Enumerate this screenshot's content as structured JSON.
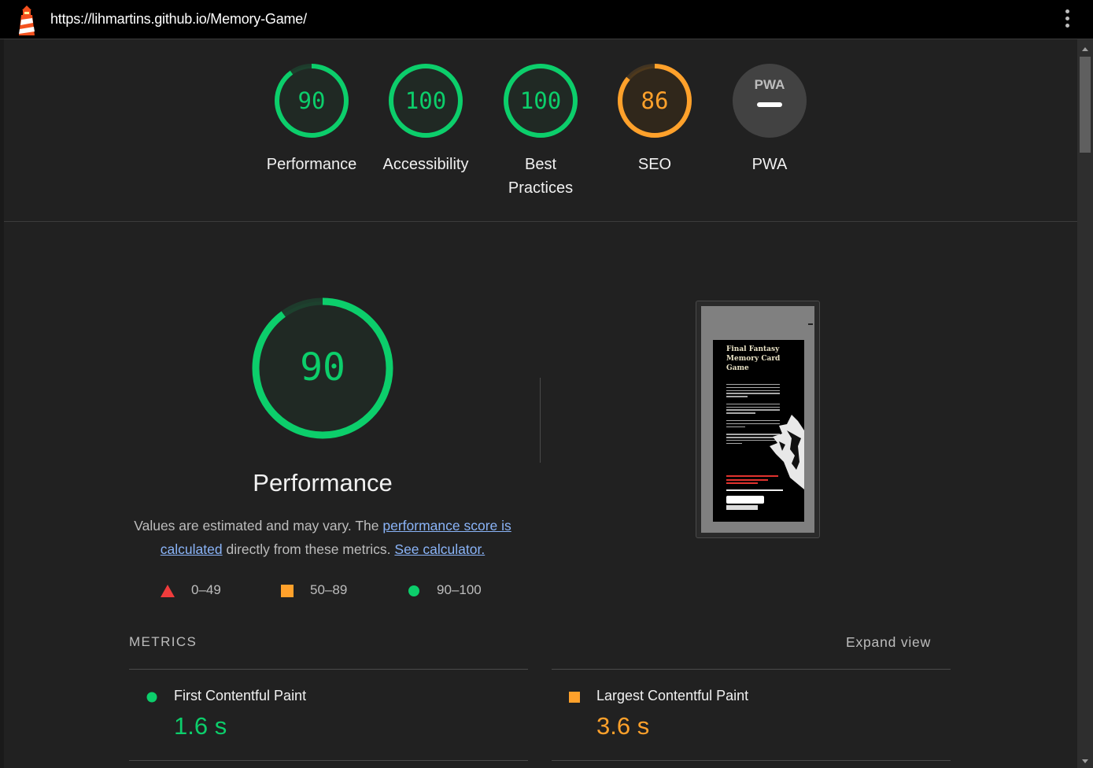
{
  "browser": {
    "url": "https://lihmartins.github.io/Memory-Game/"
  },
  "gauges": [
    {
      "score": "90",
      "label": "Performance",
      "status": "pass"
    },
    {
      "score": "100",
      "label": "Accessibility",
      "status": "pass"
    },
    {
      "score": "100",
      "label": "Best Practices",
      "status": "pass"
    },
    {
      "score": "86",
      "label": "SEO",
      "status": "average"
    },
    {
      "score": "",
      "label": "PWA",
      "status": "na",
      "badge": "PWA"
    }
  ],
  "performance": {
    "score": "90",
    "title": "Performance",
    "desc_prefix": "Values are estimated and may vary. The ",
    "desc_link1": "performance score is calculated",
    "desc_mid": " directly from these metrics. ",
    "desc_link2": "See calculator."
  },
  "legend": [
    {
      "range": "0–49",
      "shape": "triangle",
      "color": "#f03c3c"
    },
    {
      "range": "50–89",
      "shape": "square",
      "color": "#ffa12b"
    },
    {
      "range": "90–100",
      "shape": "circle",
      "color": "#0cce6b"
    }
  ],
  "screenshot": {
    "title_lines": [
      "Final Fantasy",
      "Memory Card",
      "Game"
    ]
  },
  "metrics": {
    "heading": "METRICS",
    "expand_label": "Expand view",
    "items": [
      {
        "name": "First Contentful Paint",
        "value": "1.6 s",
        "status": "pass",
        "color": "#0cce6b"
      },
      {
        "name": "Largest Contentful Paint",
        "value": "3.6 s",
        "status": "average",
        "color": "#ffa12b"
      }
    ]
  },
  "colors": {
    "pass": "#0cce6b",
    "average": "#ffa12b",
    "fail": "#f03c3c",
    "link": "#8ab4f8"
  }
}
